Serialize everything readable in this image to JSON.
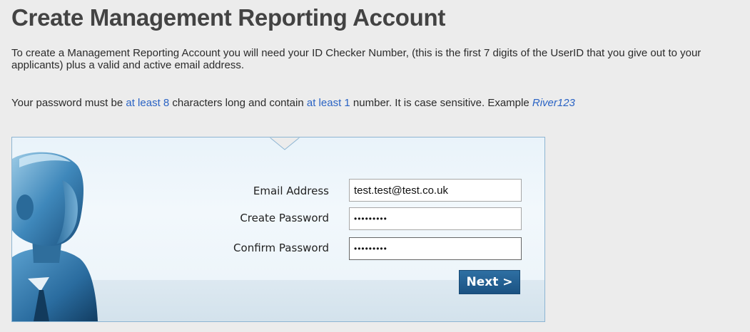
{
  "page": {
    "title": "Create Management Reporting Account",
    "intro": "To create a Management Reporting Account you will need your ID Checker Number, (this is the first 7 digits of the UserID that you give out to your applicants) plus a valid and active email address.",
    "password_rule": {
      "prefix": "Your password must be ",
      "min_length": "at least 8",
      "middle": " characters long and contain ",
      "min_numbers": "at least 1",
      "suffix": " number. It is case sensitive. Example ",
      "example": "River123"
    }
  },
  "form": {
    "email": {
      "label": "Email Address",
      "value": "test.test@test.co.uk"
    },
    "create_password": {
      "label": "Create Password",
      "value": "•••••••••"
    },
    "confirm_password": {
      "label": "Confirm Password",
      "value": "•••••••••"
    },
    "next_button": "Next >"
  },
  "colors": {
    "highlight": "#2a63c4",
    "button": "#1f5a8a",
    "panel_border": "#8db5d2"
  },
  "icons": {
    "avatar": "user-silhouette-illustration"
  }
}
